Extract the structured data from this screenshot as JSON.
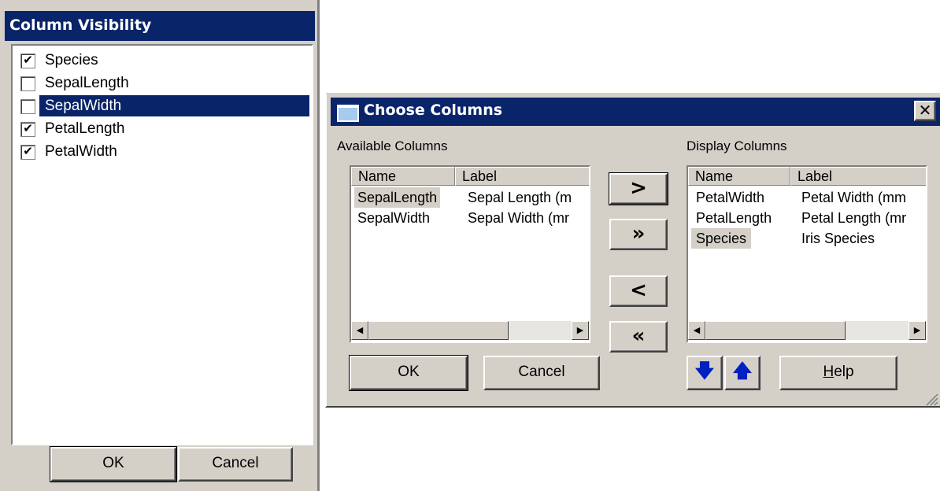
{
  "column_visibility": {
    "title": "Column Visibility",
    "items": [
      {
        "label": "Species",
        "checked": true,
        "check": "✔"
      },
      {
        "label": "SepalLength",
        "checked": false,
        "check": ""
      },
      {
        "label": "SepalWidth",
        "checked": false,
        "check": "",
        "selected": true
      },
      {
        "label": "PetalLength",
        "checked": true,
        "check": "✔"
      },
      {
        "label": "PetalWidth",
        "checked": true,
        "check": "✔"
      }
    ],
    "ok_label": "OK",
    "cancel_label": "Cancel"
  },
  "choose_columns": {
    "title": "Choose Columns",
    "close_glyph": "✕",
    "available": {
      "label": "Available Columns",
      "headers": {
        "name": "Name",
        "label": "Label"
      },
      "rows": [
        {
          "name": "SepalLength",
          "label": "Sepal Length (m"
        },
        {
          "name": "SepalWidth",
          "label": "Sepal Width (mr"
        }
      ]
    },
    "display": {
      "label": "Display Columns",
      "headers": {
        "name": "Name",
        "label": "Label"
      },
      "rows": [
        {
          "name": "PetalWidth",
          "label": "Petal Width (mm"
        },
        {
          "name": "PetalLength",
          "label": "Petal Length (mr"
        },
        {
          "name": "Species",
          "label": "Iris Species"
        }
      ]
    },
    "move_buttons": {
      "add": ">",
      "add_all": "»",
      "remove": "<",
      "remove_all": "«"
    },
    "ok_label": "OK",
    "cancel_label": "Cancel",
    "help_label_first": "H",
    "help_label_rest": "elp",
    "move_down_glyph": "🡇",
    "move_up_glyph": "🡅",
    "scroll_left_glyph": "◀",
    "scroll_right_glyph": "▶"
  }
}
